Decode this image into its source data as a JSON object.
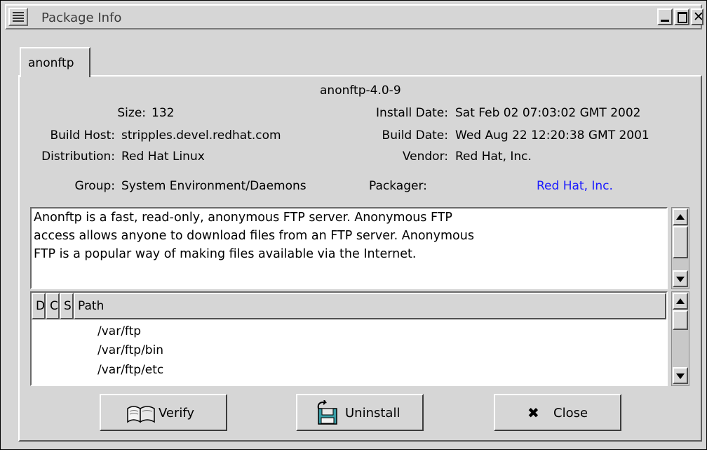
{
  "window": {
    "title": "Package Info"
  },
  "tab": {
    "label": "anonftp"
  },
  "package": {
    "name": "anonftp-4.0-9",
    "fields": {
      "size_label": "Size:",
      "size_value": "132",
      "build_host_label": "Build Host:",
      "build_host_value": "stripples.devel.redhat.com",
      "distribution_label": "Distribution:",
      "distribution_value": "Red Hat Linux",
      "group_label": "Group:",
      "group_value": "System Environment/Daemons",
      "install_date_label": "Install Date:",
      "install_date_value": "Sat Feb 02 07:03:02 GMT 2002",
      "build_date_label": "Build Date:",
      "build_date_value": "Wed Aug 22 12:20:38 GMT 2001",
      "vendor_label": "Vendor:",
      "vendor_value": "Red Hat, Inc.",
      "packager_label": "Packager:",
      "packager_value": "Red Hat, Inc."
    },
    "description_lines": [
      "Anonftp is a fast, read-only, anonymous FTP server. Anonymous FTP",
      "access allows anyone to download files from an FTP server. Anonymous",
      "FTP is a popular way of making files available via the Internet."
    ]
  },
  "file_list": {
    "columns": [
      "D",
      "C",
      "S",
      "Path"
    ],
    "rows": [
      "/var/ftp",
      "/var/ftp/bin",
      "/var/ftp/etc"
    ]
  },
  "buttons": {
    "verify": "Verify",
    "uninstall": "Uninstall",
    "close": "Close"
  },
  "colors": {
    "window_bg": "#d6d6d6",
    "link": "#1a1aff"
  }
}
